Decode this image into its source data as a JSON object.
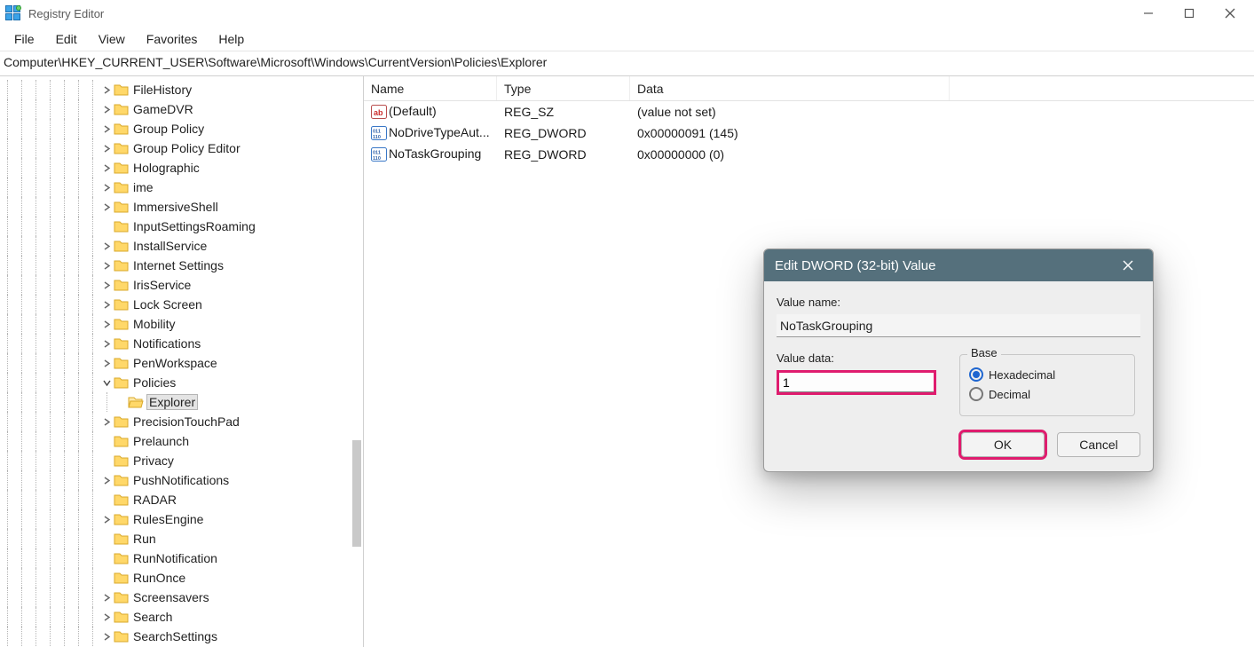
{
  "app": {
    "title": "Registry Editor"
  },
  "menu": {
    "file": "File",
    "edit": "Edit",
    "view": "View",
    "favorites": "Favorites",
    "help": "Help"
  },
  "address": "Computer\\HKEY_CURRENT_USER\\Software\\Microsoft\\Windows\\CurrentVersion\\Policies\\Explorer",
  "tree": {
    "items": [
      {
        "label": "FileHistory",
        "chev": ">",
        "depth": 7,
        "icon": "folder"
      },
      {
        "label": "GameDVR",
        "chev": ">",
        "depth": 7,
        "icon": "folder"
      },
      {
        "label": "Group Policy",
        "chev": ">",
        "depth": 7,
        "icon": "folder"
      },
      {
        "label": "Group Policy Editor",
        "chev": ">",
        "depth": 7,
        "icon": "folder"
      },
      {
        "label": "Holographic",
        "chev": ">",
        "depth": 7,
        "icon": "folder"
      },
      {
        "label": "ime",
        "chev": ">",
        "depth": 7,
        "icon": "folder"
      },
      {
        "label": "ImmersiveShell",
        "chev": ">",
        "depth": 7,
        "icon": "folder"
      },
      {
        "label": "InputSettingsRoaming",
        "chev": "",
        "depth": 7,
        "icon": "folder"
      },
      {
        "label": "InstallService",
        "chev": ">",
        "depth": 7,
        "icon": "folder"
      },
      {
        "label": "Internet Settings",
        "chev": ">",
        "depth": 7,
        "icon": "folder"
      },
      {
        "label": "IrisService",
        "chev": ">",
        "depth": 7,
        "icon": "folder"
      },
      {
        "label": "Lock Screen",
        "chev": ">",
        "depth": 7,
        "icon": "folder"
      },
      {
        "label": "Mobility",
        "chev": ">",
        "depth": 7,
        "icon": "folder"
      },
      {
        "label": "Notifications",
        "chev": ">",
        "depth": 7,
        "icon": "folder"
      },
      {
        "label": "PenWorkspace",
        "chev": ">",
        "depth": 7,
        "icon": "folder"
      },
      {
        "label": "Policies",
        "chev": "v",
        "depth": 7,
        "icon": "folder"
      },
      {
        "label": "Explorer",
        "chev": "",
        "depth": 8,
        "icon": "folder-open",
        "selected": true
      },
      {
        "label": "PrecisionTouchPad",
        "chev": ">",
        "depth": 7,
        "icon": "folder"
      },
      {
        "label": "Prelaunch",
        "chev": "",
        "depth": 7,
        "icon": "folder"
      },
      {
        "label": "Privacy",
        "chev": "",
        "depth": 7,
        "icon": "folder"
      },
      {
        "label": "PushNotifications",
        "chev": ">",
        "depth": 7,
        "icon": "folder"
      },
      {
        "label": "RADAR",
        "chev": "",
        "depth": 7,
        "icon": "folder"
      },
      {
        "label": "RulesEngine",
        "chev": ">",
        "depth": 7,
        "icon": "folder"
      },
      {
        "label": "Run",
        "chev": "",
        "depth": 7,
        "icon": "folder"
      },
      {
        "label": "RunNotification",
        "chev": "",
        "depth": 7,
        "icon": "folder"
      },
      {
        "label": "RunOnce",
        "chev": "",
        "depth": 7,
        "icon": "folder"
      },
      {
        "label": "Screensavers",
        "chev": ">",
        "depth": 7,
        "icon": "folder"
      },
      {
        "label": "Search",
        "chev": ">",
        "depth": 7,
        "icon": "folder"
      },
      {
        "label": "SearchSettings",
        "chev": ">",
        "depth": 7,
        "icon": "folder"
      }
    ]
  },
  "list": {
    "headers": {
      "name": "Name",
      "type": "Type",
      "data": "Data"
    },
    "rows": [
      {
        "icon": "ab",
        "name": "(Default)",
        "type": "REG_SZ",
        "data": "(value not set)"
      },
      {
        "icon": "num",
        "name": "NoDriveTypeAut...",
        "type": "REG_DWORD",
        "data": "0x00000091 (145)"
      },
      {
        "icon": "num",
        "name": "NoTaskGrouping",
        "type": "REG_DWORD",
        "data": "0x00000000 (0)"
      }
    ]
  },
  "dialog": {
    "title": "Edit DWORD (32-bit) Value",
    "value_name_label": "Value name:",
    "value_name": "NoTaskGrouping",
    "value_data_label": "Value data:",
    "value_data": "1",
    "base_label": "Base",
    "hex_label": "Hexadecimal",
    "dec_label": "Decimal",
    "ok": "OK",
    "cancel": "Cancel"
  }
}
